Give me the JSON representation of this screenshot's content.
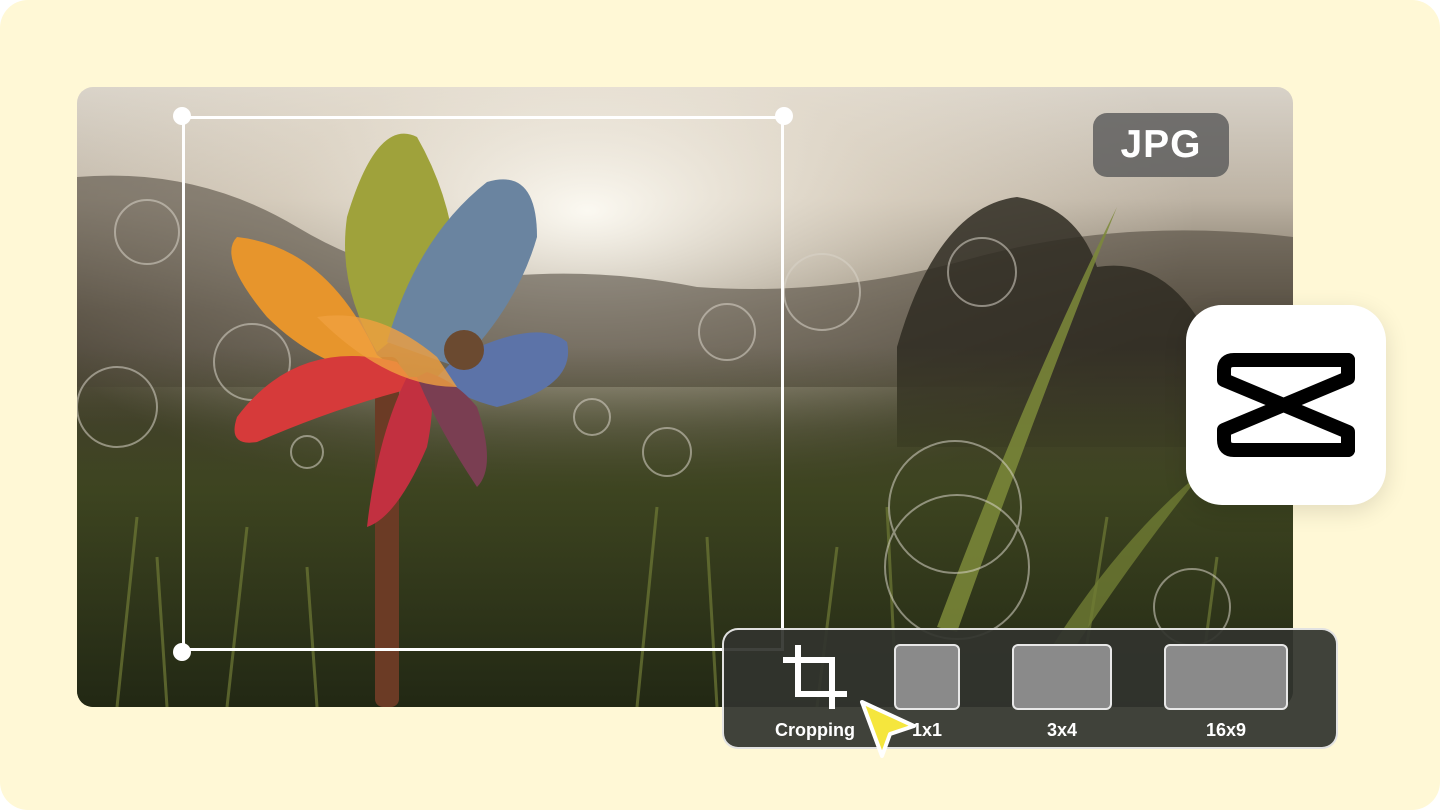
{
  "badge": {
    "format": "JPG"
  },
  "logo": {
    "icon": "capcut-logo-icon"
  },
  "toolbar": {
    "cropping_label": "Cropping",
    "ratios": [
      {
        "label": "1x1"
      },
      {
        "label": "3x4"
      },
      {
        "label": "16x9"
      }
    ]
  },
  "colors": {
    "background": "#FFF8D6",
    "toolbar_bg": "#32342E",
    "cursor": "#F5E63D",
    "ratio_box": "#8A8A8A"
  }
}
